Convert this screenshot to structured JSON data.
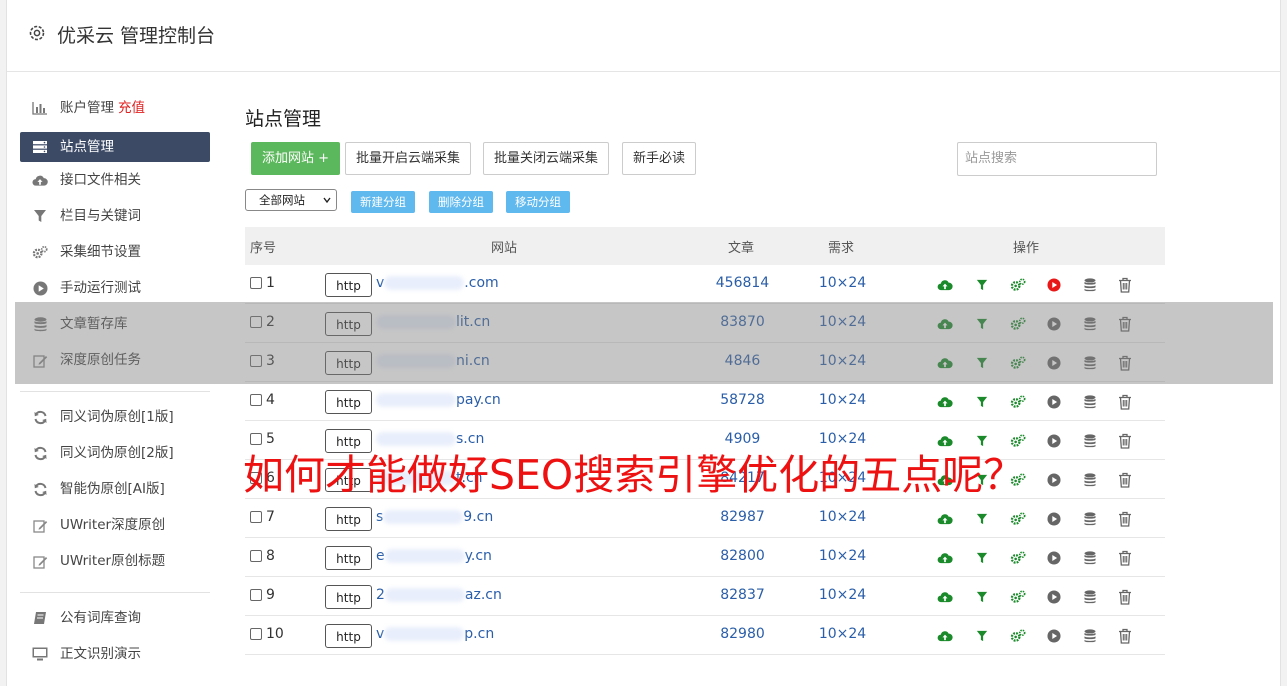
{
  "header": {
    "title": "优采云 管理控制台"
  },
  "sidebar": {
    "items": [
      {
        "label": "账户管理",
        "extra": "充值",
        "icon": "bar-chart-icon"
      },
      {
        "label": "站点管理",
        "icon": "server-icon",
        "active": true
      },
      {
        "label": "接口文件相关",
        "icon": "cloud-upload-icon"
      },
      {
        "label": "栏目与关键词",
        "icon": "filter-icon"
      },
      {
        "label": "采集细节设置",
        "icon": "cogs-icon"
      },
      {
        "label": "手动运行测试",
        "icon": "play-icon"
      },
      {
        "label": "文章暂存库",
        "icon": "database-icon"
      },
      {
        "label": "深度原创任务",
        "icon": "edit-icon"
      }
    ],
    "items2": [
      {
        "label": "同义词伪原创[1版]",
        "icon": "refresh-icon"
      },
      {
        "label": "同义词伪原创[2版]",
        "icon": "refresh-icon"
      },
      {
        "label": "智能伪原创[AI版]",
        "icon": "refresh-icon"
      },
      {
        "label": "UWriter深度原创",
        "icon": "edit-icon"
      },
      {
        "label": "UWriter原创标题",
        "icon": "edit-icon"
      }
    ],
    "items3": [
      {
        "label": "公有词库查询",
        "icon": "book-icon"
      },
      {
        "label": "正文识别演示",
        "icon": "monitor-icon"
      }
    ]
  },
  "main": {
    "title": "站点管理",
    "buttons": {
      "add": "添加网站 +",
      "enable_all": "批量开启云端采集",
      "disable_all": "批量关闭云端采集",
      "guide": "新手必读"
    },
    "search_placeholder": "站点搜索",
    "group_select": "全部网站",
    "group_buttons": {
      "new": "新建分组",
      "delete": "删除分组",
      "move": "移动分组"
    }
  },
  "table": {
    "headers": {
      "index": "序号",
      "site": "网站",
      "articles": "文章",
      "demand": "需求",
      "ops": "操作"
    },
    "rows": [
      {
        "n": "1",
        "proto": "http",
        "pre": "v",
        "post": ".com",
        "articles": "456814",
        "demand": "10×24",
        "play_active": true
      },
      {
        "n": "2",
        "proto": "http",
        "pre": "",
        "post": "lit.cn",
        "articles": "83870",
        "demand": "10×24"
      },
      {
        "n": "3",
        "proto": "http",
        "pre": "",
        "post": "ni.cn",
        "articles": "4846",
        "demand": "10×24"
      },
      {
        "n": "4",
        "proto": "http",
        "pre": "",
        "post": "pay.cn",
        "articles": "58728",
        "demand": "10×24"
      },
      {
        "n": "5",
        "proto": "http",
        "pre": "",
        "post": "s.cn",
        "articles": "4909",
        "demand": "10×24"
      },
      {
        "n": "6",
        "proto": "http",
        "pre": "",
        "post": "t.cn",
        "articles": "84217",
        "demand": "10×24"
      },
      {
        "n": "7",
        "proto": "http",
        "pre": "s",
        "post": "9.cn",
        "articles": "82987",
        "demand": "10×24"
      },
      {
        "n": "8",
        "proto": "http",
        "pre": "e",
        "post": "y.cn",
        "articles": "82800",
        "demand": "10×24"
      },
      {
        "n": "9",
        "proto": "http",
        "pre": "2",
        "post": "az.cn",
        "articles": "82837",
        "demand": "10×24"
      },
      {
        "n": "10",
        "proto": "http",
        "pre": "v",
        "post": "p.cn",
        "articles": "82980",
        "demand": "10×24"
      }
    ]
  },
  "overlay_text": "如何才能做好SEO搜索引擎优化的五点呢？",
  "colors": {
    "accent_green": "#5cb85c",
    "nav_active": "#3c4a66",
    "link_blue": "#2a5ea8",
    "group_btn": "#5fb8ee",
    "banner_red": "#ee1111"
  }
}
